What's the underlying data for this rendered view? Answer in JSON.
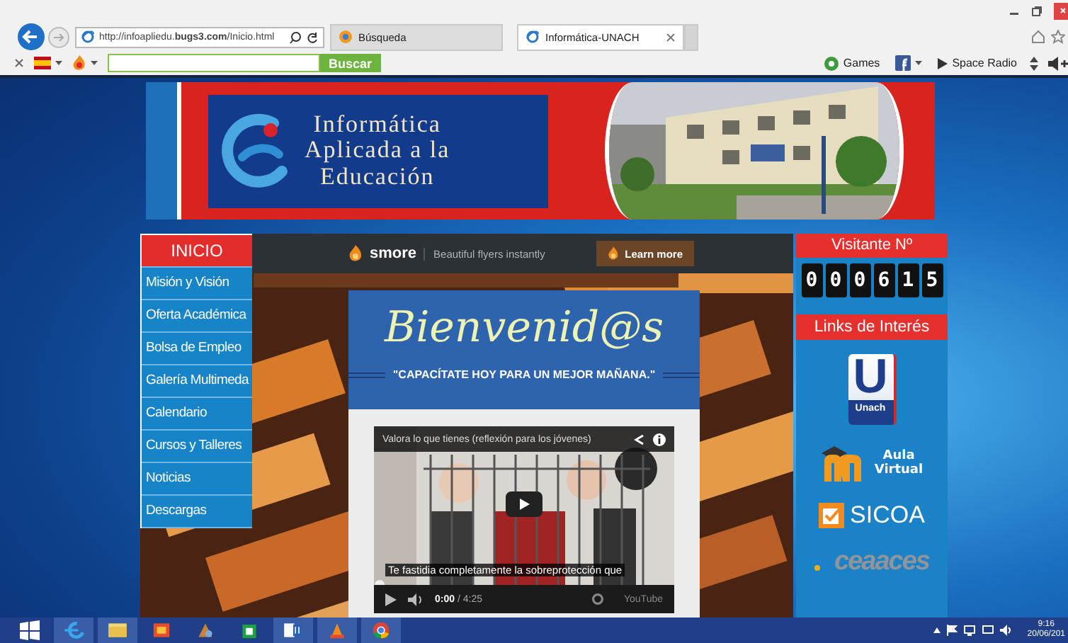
{
  "browser": {
    "address": "http://infoapliedu.**bugs3.com**/Inicio.html",
    "tabs": [
      {
        "label": "Búsqueda",
        "selected": false
      },
      {
        "label": "Informática-UNACH",
        "selected": true
      }
    ],
    "search_button": "Buscar",
    "games": "Games",
    "radio": "Space Radio"
  },
  "banner": {
    "title": [
      "Informática",
      "Aplicada a la",
      "Educación"
    ]
  },
  "nav": [
    {
      "label": "INICIO",
      "selected": true
    },
    {
      "label": "Misión y Visión",
      "selected": false
    },
    {
      "label": "Oferta Académica",
      "selected": false
    },
    {
      "label": "Bolsa de Empleo",
      "selected": false
    },
    {
      "label": "Galería Multimeda",
      "selected": false
    },
    {
      "label": "Calendario",
      "selected": false
    },
    {
      "label": "Cursos y Talleres",
      "selected": false
    },
    {
      "label": "Noticias",
      "selected": false
    },
    {
      "label": "Descargas",
      "selected": false
    }
  ],
  "smore": {
    "brand": "smore",
    "tagline": "Beautiful flyers instantly",
    "button": "Learn more"
  },
  "welcome": {
    "heading": "Bienvenid@s",
    "slogan": "\"CAPACÍTATE HOY PARA UN MEJOR MAÑANA.\""
  },
  "video": {
    "title": "Valora lo que tienes (reflexión para los jóvenes)",
    "caption": "Te fastidia completamente la sobreprotección que",
    "time": "0:00",
    "duration": "/ 4:25",
    "logo": "YouTube"
  },
  "visitors": {
    "heading": "Visitante Nº",
    "digits": [
      "0",
      "0",
      "0",
      "6",
      "1",
      "5"
    ]
  },
  "links": {
    "heading": "Links de Interés",
    "items": [
      {
        "kind": "unach",
        "letter": "U",
        "label": "Unach"
      },
      {
        "kind": "moodle",
        "label": "Aula Virtual"
      },
      {
        "kind": "sicoa",
        "label": "SICOA"
      },
      {
        "kind": "ceaaces",
        "label": "ceaaces"
      }
    ]
  },
  "taskbar": {
    "apps": [
      {
        "kind": "ie",
        "running": true
      },
      {
        "kind": "folder",
        "running": true
      },
      {
        "kind": "media",
        "running": false
      },
      {
        "kind": "paint",
        "running": false
      },
      {
        "kind": "store",
        "running": false
      },
      {
        "kind": "word",
        "running": true
      },
      {
        "kind": "vlc",
        "running": true
      },
      {
        "kind": "chrome",
        "running": true
      }
    ],
    "time": "9:16",
    "date": "20/06/201"
  }
}
